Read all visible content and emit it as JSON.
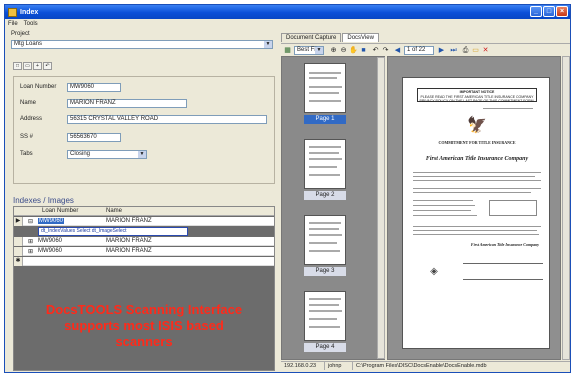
{
  "window": {
    "title": "Index"
  },
  "menu": [
    "File",
    "Tools"
  ],
  "project": {
    "label": "Project",
    "value": "Mtg Loans"
  },
  "form": {
    "loan_number_label": "Loan Number",
    "loan_number": "MW9060",
    "name_label": "Name",
    "name": "MARION  FRANZ",
    "address_label": "Address",
    "address": "56315 CRYSTAL VALLEY ROAD",
    "ss_label": "SS #",
    "ss": "56563670",
    "tabs_label": "Tabs",
    "tabs_value": "Closing"
  },
  "grid": {
    "heading": "Indexes / Images",
    "columns": [
      "Loan Number",
      "Name"
    ],
    "rows": [
      {
        "loan": "MW9060",
        "name": "MARION  FRANZ"
      },
      {
        "loan": "MW9060",
        "name": "MARION  FRANZ"
      },
      {
        "loan": "MW9060",
        "name": "MARION  FRANZ"
      }
    ],
    "link_text": "dt_IndexValues Select dt_ImageSelect"
  },
  "overlay_text": [
    "DocsTOOLS Scanning Interface",
    "supports most ISIS based",
    "scanners"
  ],
  "right": {
    "tabs": [
      "Document Capture",
      "DocsView"
    ],
    "fit_label": "Best Fit",
    "page_counter": "1 of 22",
    "thumbnails": [
      "Page 1",
      "Page 2",
      "Page 3",
      "Page 4"
    ]
  },
  "document": {
    "notice_title": "IMPORTANT NOTICE",
    "notice_text": "PLEASE READ THE FIRST AMERICAN TITLE INSURANCE COMPANY PRIVACY POLICY ON THE LAST PAGE OF THIS COMMITMENT FORM.",
    "commitment_title": "COMMITMENT FOR TITLE INSURANCE",
    "company": "First American Title Insurance Company",
    "company_bottom": "First American Title Insurance Company"
  },
  "status": [
    "192.168.0.23",
    "johnp",
    "C:\\Program Files\\DISC\\DocsEnable\\DocsEnable.mdb"
  ]
}
